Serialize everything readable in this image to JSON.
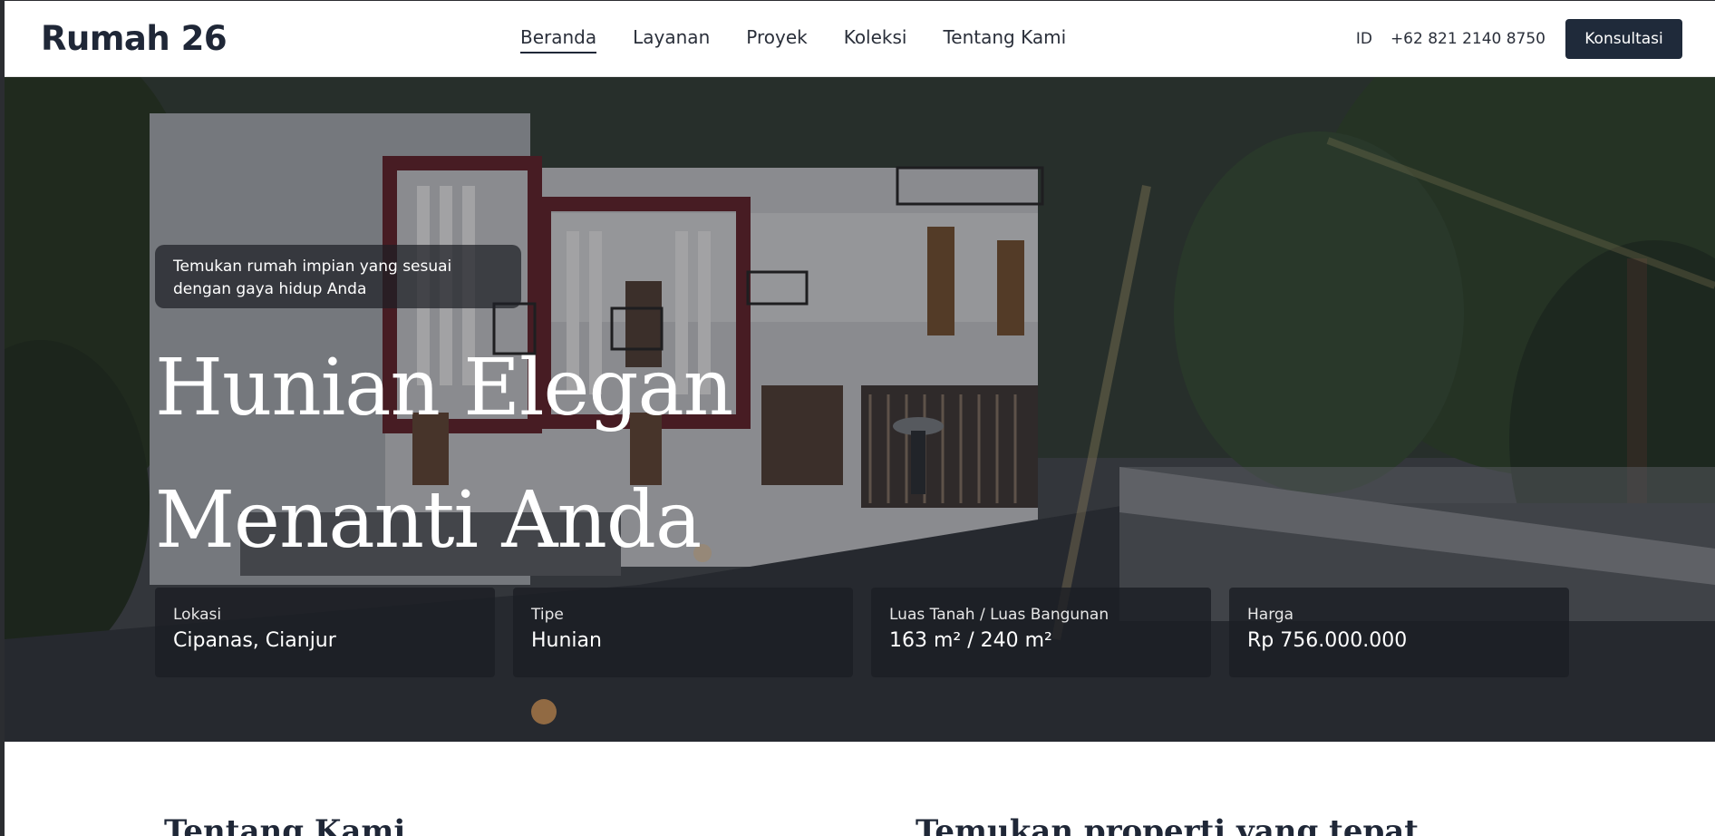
{
  "brand": "Rumah 26",
  "nav": {
    "items": [
      {
        "label": "Beranda",
        "active": true
      },
      {
        "label": "Layanan"
      },
      {
        "label": "Proyek"
      },
      {
        "label": "Koleksi"
      },
      {
        "label": "Tentang Kami"
      }
    ]
  },
  "header_right": {
    "lang": "ID",
    "phone": "+62 821 2140 8750",
    "cta": "Konsultasi"
  },
  "hero": {
    "tagline": "Temukan rumah impian yang sesuai dengan gaya hidup Anda",
    "headline_line1": "Hunian Elegan",
    "headline_line2": "Menanti Anda",
    "cards": [
      {
        "label": "Lokasi",
        "value": "Cipanas, Cianjur"
      },
      {
        "label": "Tipe",
        "value": "Hunian"
      },
      {
        "label": "Luas Tanah / Luas Bangunan",
        "value": "163 m² / 240 m²"
      },
      {
        "label": "Harga",
        "value": "Rp 756.000.000"
      }
    ]
  },
  "sections": {
    "about_title": "Tentang Kami",
    "find_title": "Temukan properti yang tepat"
  },
  "colors": {
    "primary": "#1f2a3a",
    "text": "#2a2f3a"
  }
}
